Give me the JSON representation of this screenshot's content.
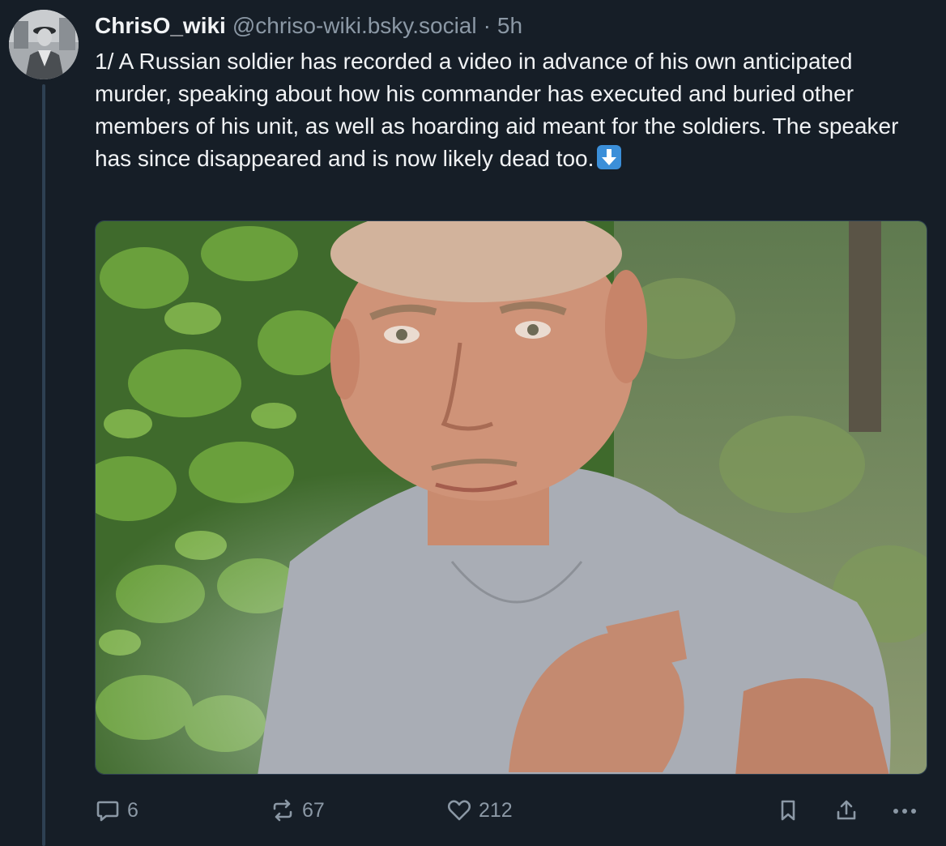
{
  "post": {
    "author": {
      "display_name": "ChrisO_wiki",
      "handle": "@chriso-wiki.bsky.social",
      "separator": "·",
      "timestamp": "5h",
      "avatar_icon": "avatar-photo"
    },
    "text": "1/ A Russian soldier has recorded a video in advance of his own anticipated murder, speaking about how his commander has executed and buried other members of his unit, as well as hoarding aid meant for the soldiers. The speaker has since disappeared and is now likely dead too.",
    "text_emoji": "down-arrow-emoji",
    "media": {
      "kind": "photo"
    },
    "actions": {
      "reply_count": "6",
      "repost_count": "67",
      "like_count": "212"
    }
  },
  "colors": {
    "background": "#161e27",
    "text": "#f1f3f5",
    "muted": "#8b98a5",
    "thread_line": "#2e4052",
    "emoji_blue": "#3b8fd9"
  }
}
